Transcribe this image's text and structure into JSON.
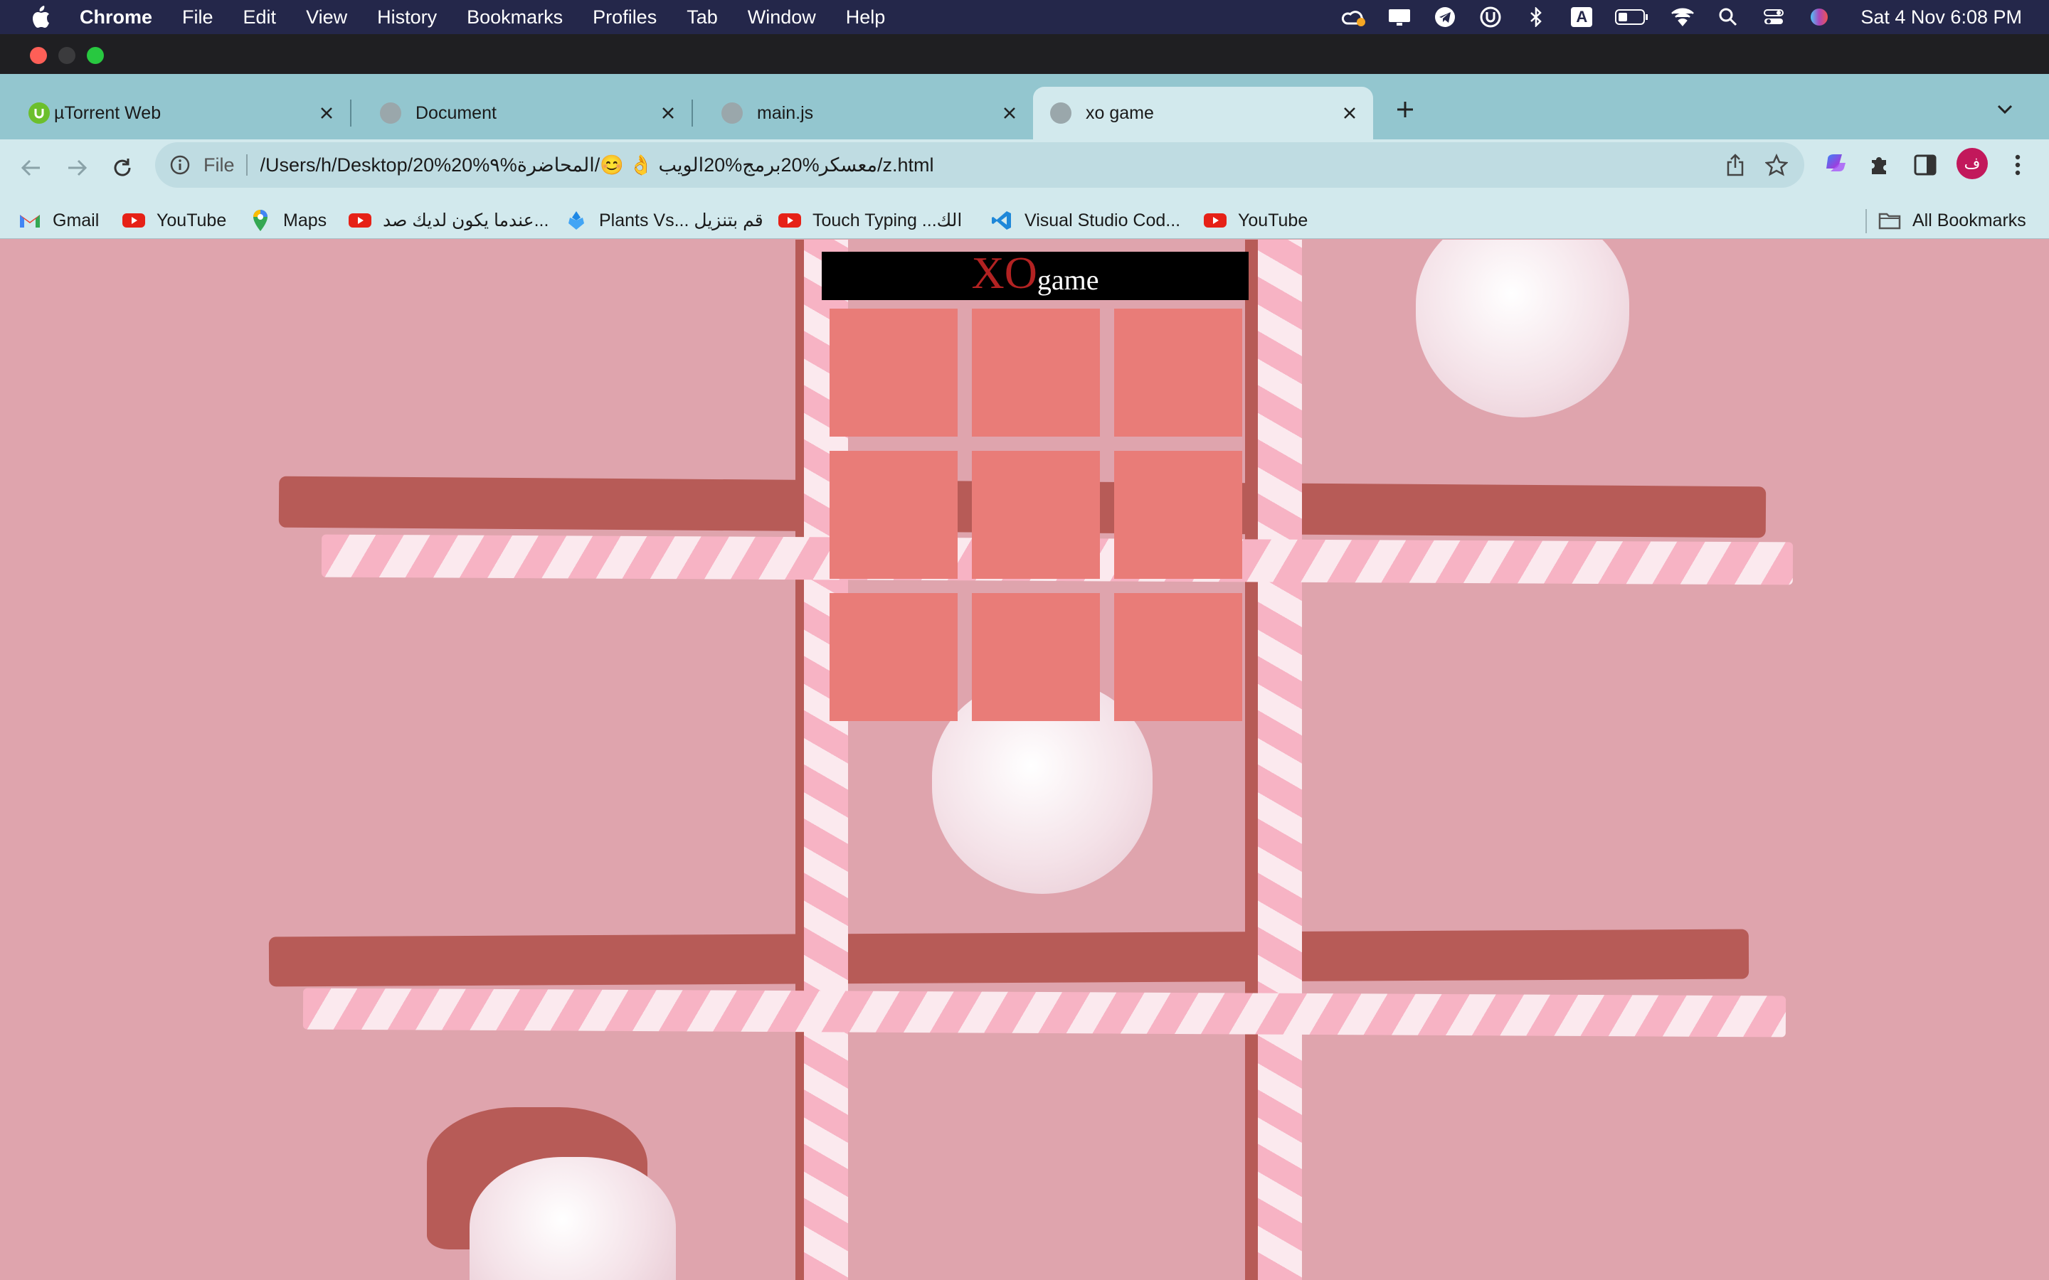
{
  "menubar": {
    "app_name": "Chrome",
    "items": [
      "File",
      "Edit",
      "View",
      "History",
      "Bookmarks",
      "Profiles",
      "Tab",
      "Window",
      "Help"
    ],
    "clock": "Sat 4 Nov  6:08 PM",
    "status_icons": [
      "creative-cloud-icon",
      "screen-share-icon",
      "telegram-icon",
      "utorrent-icon",
      "bluetooth-icon",
      "input-source-icon",
      "battery-icon",
      "wifi-icon",
      "spotlight-search-icon",
      "control-center-icon",
      "siri-icon"
    ],
    "input_source_letter": "A"
  },
  "tabs": [
    {
      "title": "µTorrent Web",
      "active": false
    },
    {
      "title": "Document",
      "active": false
    },
    {
      "title": "main.js",
      "active": false
    },
    {
      "title": "xo game",
      "active": true
    }
  ],
  "address_bar": {
    "scheme": "File",
    "url": "/Users/h/Desktop/معسكر%20برمج%20الويب 👌 😊/المحاضرة%٩%20%20/z.html"
  },
  "profile_initial": "ف",
  "bookmarks": [
    {
      "label": "Gmail",
      "icon": "gmail-icon"
    },
    {
      "label": "YouTube",
      "icon": "youtube-icon"
    },
    {
      "label": "Maps",
      "icon": "maps-icon"
    },
    {
      "label": "عندما يكون لديك صد...",
      "icon": "youtube-icon"
    },
    {
      "label": "Plants Vs... قم بتنزيل",
      "icon": "plants-vs-zombies-icon"
    },
    {
      "label": "Touch Typing ...الك",
      "icon": "youtube-icon"
    },
    {
      "label": "Visual Studio Cod...",
      "icon": "vscode-icon"
    },
    {
      "label": "YouTube",
      "icon": "youtube-icon"
    }
  ],
  "all_bookmarks_label": "All Bookmarks",
  "game": {
    "title_xo": "XO",
    "title_game": "game",
    "cells": [
      "",
      "",
      "",
      "",
      "",
      "",
      "",
      "",
      ""
    ]
  },
  "colors": {
    "menubar": "#24274a",
    "tab_strip": "#93c6cf",
    "toolbar": "#d2e9ed",
    "page_background": "#dfa4ad",
    "cell": "#e97c78",
    "title_bar": "#000000",
    "title_xo": "#b22222",
    "title_game": "#ffffff"
  }
}
